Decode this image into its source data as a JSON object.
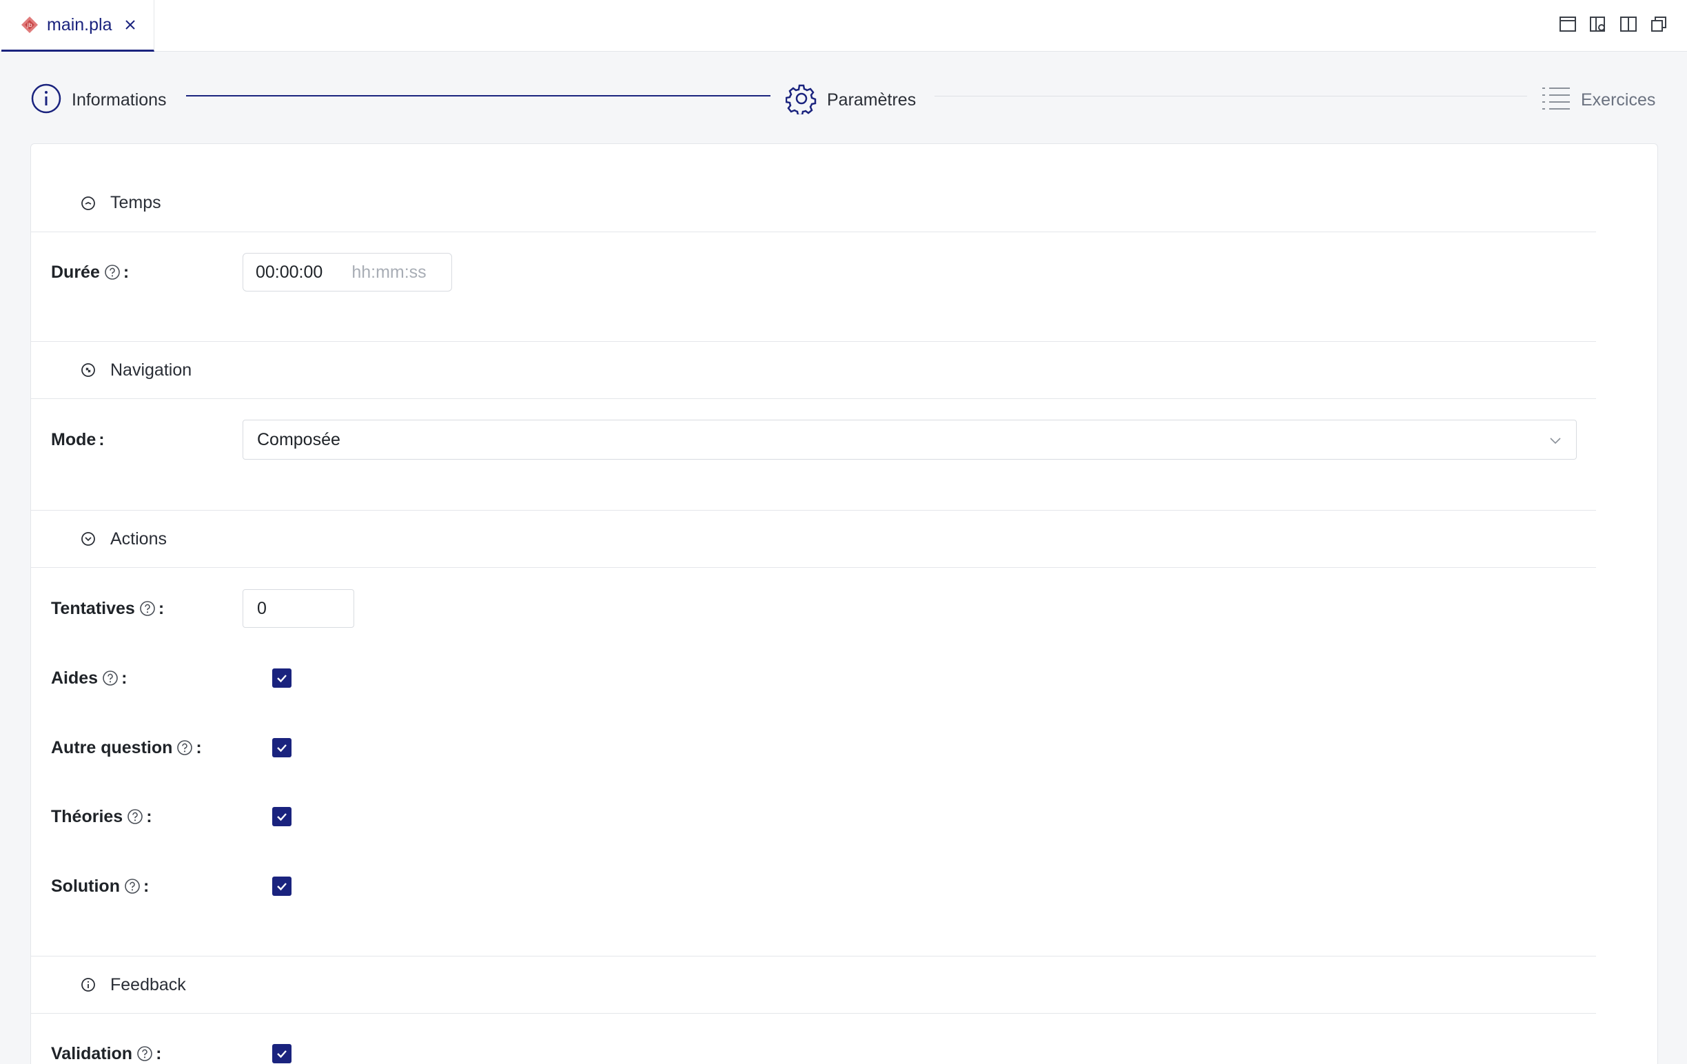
{
  "tab": {
    "file_name": "main.pla"
  },
  "stepper": {
    "steps": [
      {
        "label": "Informations"
      },
      {
        "label": "Paramètres"
      },
      {
        "label": "Exercices"
      }
    ]
  },
  "colors": {
    "accent": "#1a237e",
    "border": "#e4e6ea"
  },
  "sections": {
    "temps": {
      "title": "Temps",
      "duree": {
        "label": "Durée",
        "value": "00:00:00",
        "hint": "hh:mm:ss"
      }
    },
    "navigation": {
      "title": "Navigation",
      "mode": {
        "label": "Mode",
        "selected": "Composée"
      }
    },
    "actions": {
      "title": "Actions",
      "tentatives": {
        "label": "Tentatives",
        "value": "0"
      },
      "aides": {
        "label": "Aides",
        "checked": true
      },
      "autre_question": {
        "label": "Autre question",
        "checked": true
      },
      "theories": {
        "label": "Théories",
        "checked": true
      },
      "solution": {
        "label": "Solution",
        "checked": true
      }
    },
    "feedback": {
      "title": "Feedback",
      "validation": {
        "label": "Validation",
        "checked": true
      }
    }
  },
  "icons": {
    "tab_file": "plugin-diamond-icon",
    "tab_close": "close-icon",
    "layout": [
      "layout-single-icon",
      "layout-preview-icon",
      "layout-split-icon",
      "layout-restore-icon"
    ],
    "step_info": "info-circle-icon",
    "step_params": "gear-icon",
    "step_exercises": "list-icon",
    "help": "question-circle-icon",
    "section_temps": "clock-icon",
    "section_navigation": "compass-icon",
    "section_actions": "down-circle-icon",
    "section_feedback": "info-circle-icon",
    "select_chevron": "chevron-down-icon",
    "checkbox_check": "check-icon"
  }
}
